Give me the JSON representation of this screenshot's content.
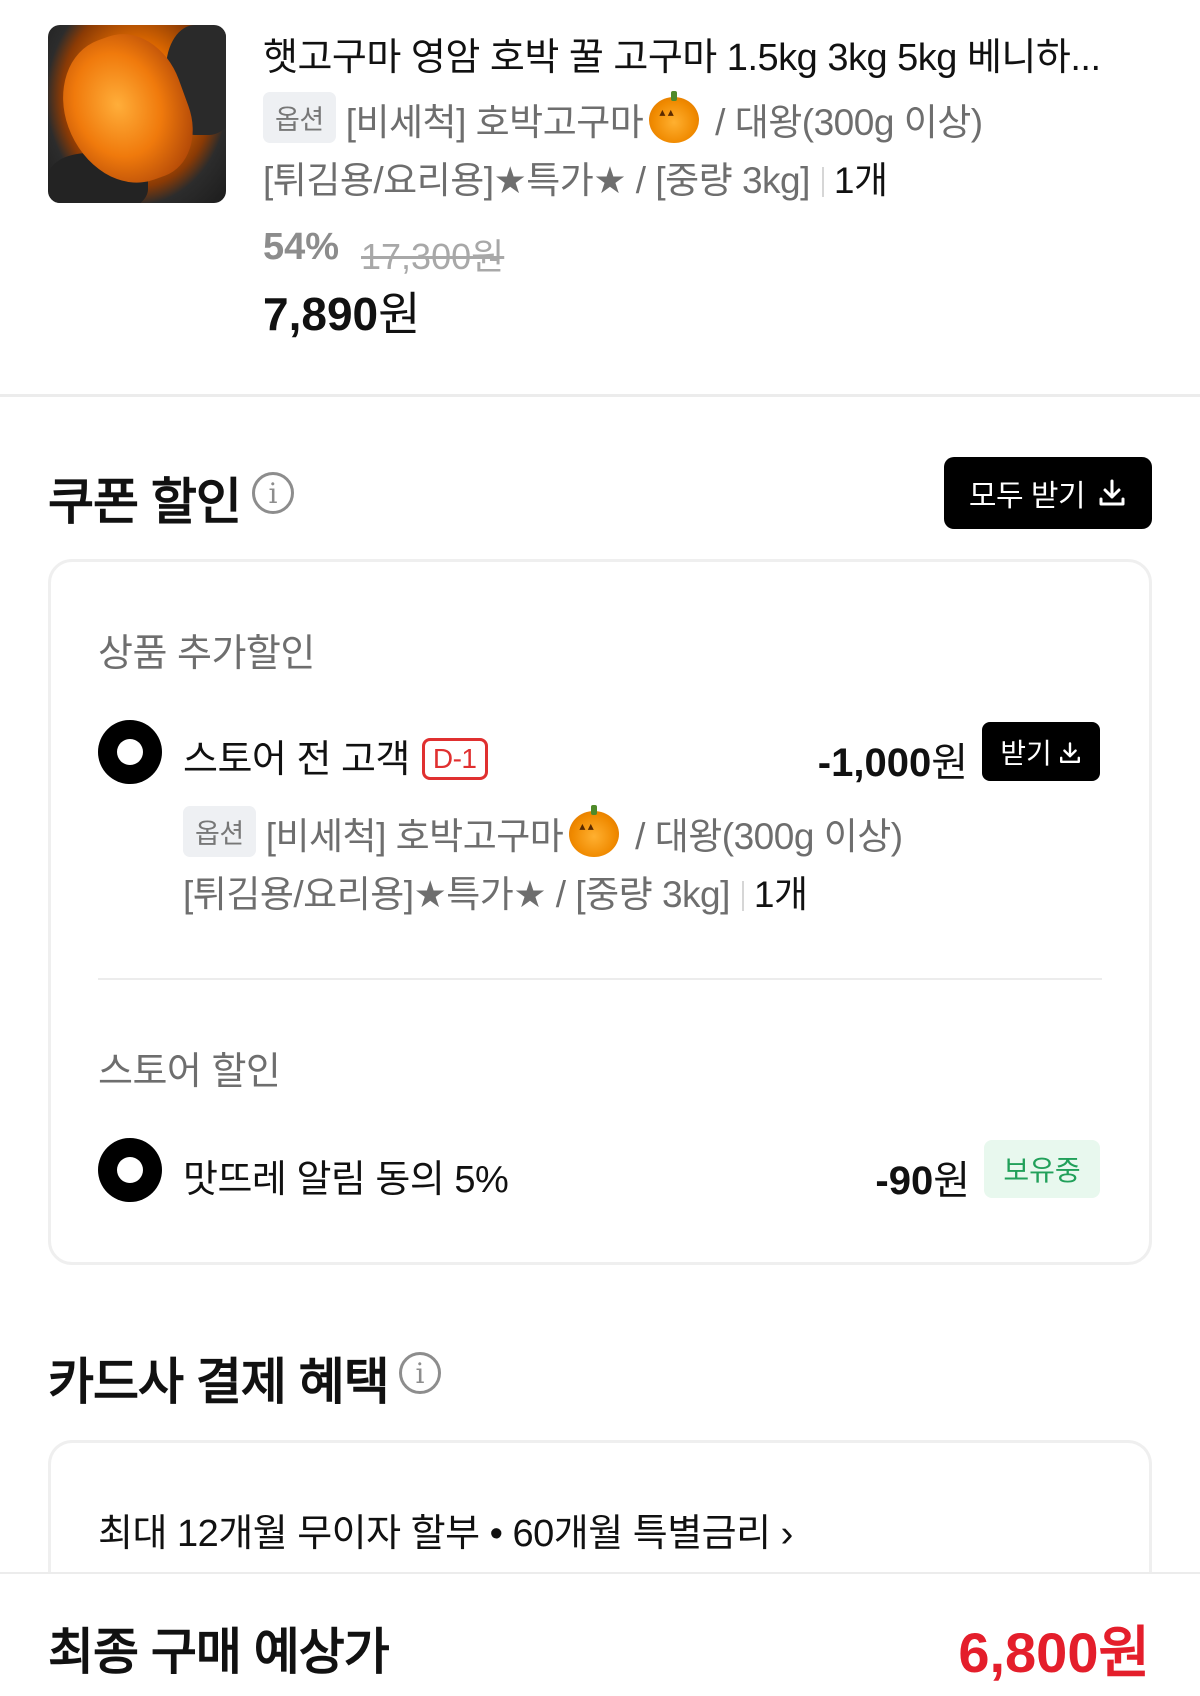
{
  "product": {
    "title": "햇고구마 영암 호박 꿀 고구마 1.5kg 3kg 5kg 베니하...",
    "option_tag": "옵션",
    "option_line1_a": "[비세척] 호박고구마",
    "option_line1_b": " / 대왕(300g 이상)",
    "option_line2": "[튀김용/요리용]★특가★ / [중량 3kg]",
    "quantity": "1개",
    "discount_percent": "54%",
    "original_price": "17,300원",
    "price_value": "7,890",
    "price_unit": "원"
  },
  "coupon": {
    "title": "쿠폰 할인",
    "download_all_label": "모두 받기",
    "product_extra": {
      "subtitle": "상품 추가할인",
      "name": "스토어 전 고객",
      "dday": "D-1",
      "amount_value": "-1,000",
      "amount_unit": "원",
      "get_label": "받기",
      "option_tag": "옵션",
      "option_line1_a": "[비세척] 호박고구마",
      "option_line1_b": " / 대왕(300g 이상)",
      "option_line2": "[튀김용/요리용]★특가★ / [중량 3kg]",
      "quantity": "1개"
    },
    "store": {
      "subtitle": "스토어 할인",
      "name": "맛뜨레 알림 동의 5%",
      "amount_value": "-90",
      "amount_unit": "원",
      "status": "보유중"
    }
  },
  "card_benefit": {
    "title": "카드사 결제 혜택",
    "text": "최대 12개월 무이자 할부 • 60개월 특별금리",
    "chevron": "›"
  },
  "final": {
    "label": "최종 구매 예상가",
    "price_value": "6,800",
    "price_unit": "원"
  },
  "colors": {
    "accent_red": "#e41e2b",
    "owned_green": "#21a05a",
    "dday_red": "#e03030"
  },
  "icons": [
    "pumpkin-emoji-icon",
    "info-icon",
    "download-icon"
  ]
}
